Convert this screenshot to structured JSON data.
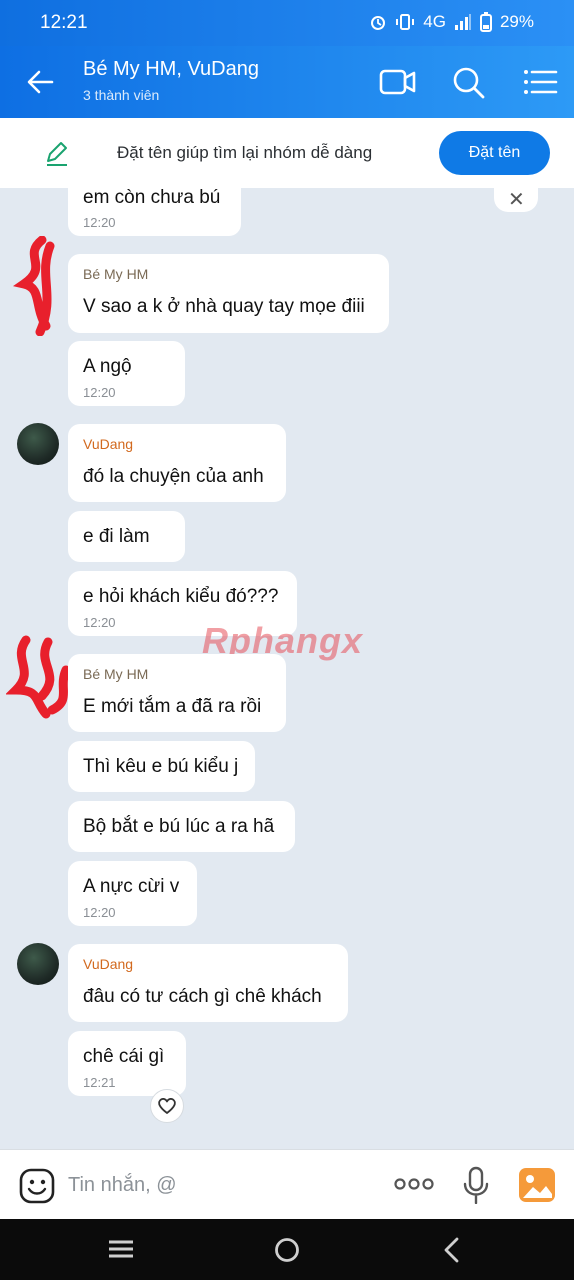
{
  "status": {
    "time": "12:21",
    "battery": "29%",
    "network": "4G"
  },
  "header": {
    "title": "Bé My HM, VuDang",
    "subtitle": "3 thành viên"
  },
  "namebar": {
    "text": "Đặt tên giúp tìm lại nhóm dễ dàng",
    "button": "Đặt tên"
  },
  "messages": [
    {
      "text": "em còn chưa bú",
      "time": "12:20"
    },
    {
      "sender": "Bé My HM",
      "text": "V sao a k ở nhà quay tay mọe điii"
    },
    {
      "text": "A ngộ",
      "time": "12:20"
    },
    {
      "sender": "VuDang",
      "text": "đó la chuyện của anh"
    },
    {
      "text": "e đi làm"
    },
    {
      "text": "e hỏi khách kiểu đó???",
      "time": "12:20"
    },
    {
      "sender": "Bé My HM",
      "text": "E mới tắm a đã ra rồi"
    },
    {
      "text": "Thì kêu e bú kiểu j"
    },
    {
      "text": "Bộ bắt e bú lúc a ra hã"
    },
    {
      "text": "A nực cừi v",
      "time": "12:20"
    },
    {
      "sender": "VuDang",
      "text": "đâu có tư cách gì chê khách"
    },
    {
      "text": "chê cái gì",
      "time": "12:21"
    }
  ],
  "watermark": "Rphangx",
  "input": {
    "placeholder": "Tin nhắn, @"
  },
  "colors": {
    "accent": "#0f7ae6",
    "sender_bemy": "#7a6a55",
    "sender_vudang": "#d2691e"
  }
}
